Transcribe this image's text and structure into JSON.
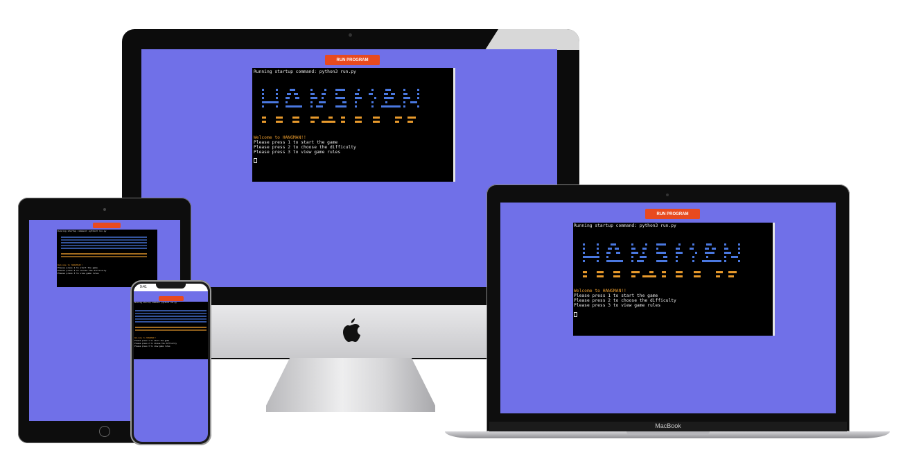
{
  "run_button": {
    "label": "RUN PROGRAM"
  },
  "terminal": {
    "command_line": "Running startup command: python3 run.py",
    "welcome": "Welcome to HANGMAN!!",
    "options": [
      "Please press 1 to start the game",
      "Please press 2 to choose the difficulty",
      "Please press 3 to view game rules"
    ]
  },
  "laptop": {
    "brand": "MacBook"
  },
  "phone": {
    "time": "9:41"
  },
  "colors": {
    "page_background": "#7070e8",
    "run_button": "#e84a1f",
    "terminal_background": "#000000",
    "ascii_art_blue": "#4a78e0",
    "ascii_art_orange": "#e89a2c"
  },
  "icons": [
    "apple-logo-icon"
  ]
}
